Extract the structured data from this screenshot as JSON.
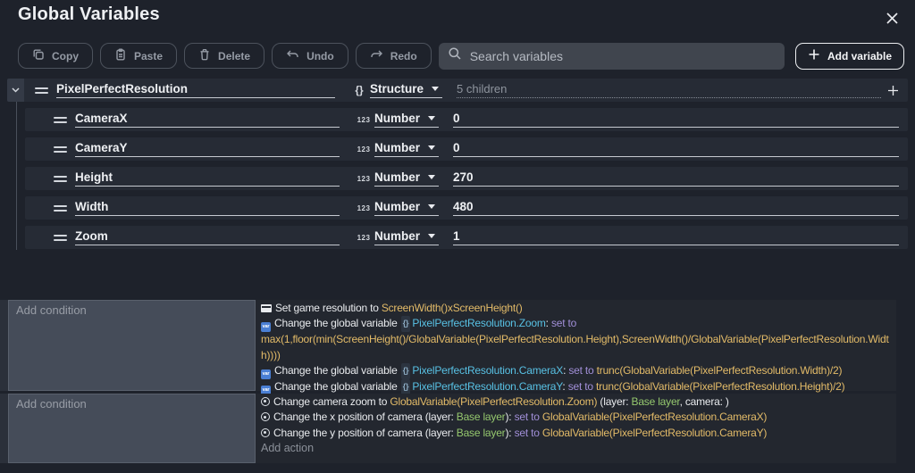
{
  "header": {
    "title": "Global Variables"
  },
  "toolbar": {
    "buttons": [
      {
        "id": "copy",
        "label": "Copy"
      },
      {
        "id": "paste",
        "label": "Paste"
      },
      {
        "id": "delete",
        "label": "Delete"
      },
      {
        "id": "undo",
        "label": "Undo"
      },
      {
        "id": "redo",
        "label": "Redo"
      }
    ],
    "search_placeholder": "Search variables",
    "add_variable_label": "Add variable"
  },
  "icons": {
    "close": "x-cross",
    "copy": "two-overlapping-squares",
    "paste": "clipboard",
    "delete": "trash-can",
    "undo": "arrow-curve-left",
    "redo": "arrow-curve-right",
    "search": "magnifier",
    "add": "plus",
    "collapse": "chevron-down",
    "drag_handle": "double-horizontal-lines",
    "structure_type": "{}",
    "number_type": "123",
    "set_resolution": "window",
    "global_variable": "var-blue-square",
    "camera": "lens-circle-dot"
  },
  "colors": {
    "accent-expression": "#e3bb68",
    "accent-variable": "#58c1e4",
    "accent-set-to": "#a18fd8",
    "accent-layer": "#95c86e"
  },
  "variables": {
    "root": {
      "name": "PixelPerfectResolution",
      "type": "Structure",
      "type_icon": "{}",
      "summary": "5 children"
    },
    "children": [
      {
        "name": "CameraX",
        "type": "Number",
        "type_icon": "123",
        "value": "0"
      },
      {
        "name": "CameraY",
        "type": "Number",
        "type_icon": "123",
        "value": "0"
      },
      {
        "name": "Height",
        "type": "Number",
        "type_icon": "123",
        "value": "270"
      },
      {
        "name": "Width",
        "type": "Number",
        "type_icon": "123",
        "value": "480"
      },
      {
        "name": "Zoom",
        "type": "Number",
        "type_icon": "123",
        "value": "1"
      }
    ]
  },
  "events": [
    {
      "condition_placeholder": "Add condition",
      "add_action_label": "Add action",
      "actions": [
        {
          "icon": "window",
          "segments": [
            {
              "k": "plain",
              "t": "Set game resolution to "
            },
            {
              "k": "expr",
              "t": "ScreenWidth()xScreenHeight()"
            }
          ]
        },
        {
          "icon": "var",
          "segments": [
            {
              "k": "plain",
              "t": "Change the global variable "
            },
            {
              "k": "badge",
              "t": "{}"
            },
            {
              "k": "var",
              "t": "PixelPerfectResolution.Zoom"
            },
            {
              "k": "plain",
              "t": ": "
            },
            {
              "k": "setto",
              "t": "set to"
            },
            {
              "k": "br",
              "t": ""
            },
            {
              "k": "expr",
              "t": "max(1,floor(min(ScreenHeight()/GlobalVariable(PixelPerfectResolution.Height),ScreenWidth()/GlobalVariable(PixelPerfectResolution.Width))))"
            }
          ]
        },
        {
          "icon": "var",
          "segments": [
            {
              "k": "plain",
              "t": "Change the global variable "
            },
            {
              "k": "badge",
              "t": "{}"
            },
            {
              "k": "var",
              "t": "PixelPerfectResolution.CameraX"
            },
            {
              "k": "plain",
              "t": ": "
            },
            {
              "k": "setto",
              "t": "set to "
            },
            {
              "k": "expr",
              "t": "trunc(GlobalVariable(PixelPerfectResolution.Width)/2)"
            }
          ]
        },
        {
          "icon": "var",
          "segments": [
            {
              "k": "plain",
              "t": "Change the global variable "
            },
            {
              "k": "badge",
              "t": "{}"
            },
            {
              "k": "var",
              "t": "PixelPerfectResolution.CameraY"
            },
            {
              "k": "plain",
              "t": ": "
            },
            {
              "k": "setto",
              "t": "set to "
            },
            {
              "k": "expr",
              "t": "trunc(GlobalVariable(PixelPerfectResolution.Height)/2)"
            }
          ]
        }
      ]
    },
    {
      "condition_placeholder": "Add condition",
      "add_action_label": "Add action",
      "actions": [
        {
          "icon": "camera",
          "segments": [
            {
              "k": "plain",
              "t": "Change camera zoom to "
            },
            {
              "k": "expr",
              "t": "GlobalVariable(PixelPerfectResolution.Zoom)"
            },
            {
              "k": "plain",
              "t": " (layer: "
            },
            {
              "k": "layer",
              "t": "Base layer"
            },
            {
              "k": "plain",
              "t": ", camera: )"
            }
          ]
        },
        {
          "icon": "camera",
          "segments": [
            {
              "k": "plain",
              "t": "Change the x position of camera (layer: "
            },
            {
              "k": "layer",
              "t": "Base layer"
            },
            {
              "k": "plain",
              "t": "): "
            },
            {
              "k": "setto",
              "t": "set to "
            },
            {
              "k": "expr",
              "t": "GlobalVariable(PixelPerfectResolution.CameraX)"
            }
          ]
        },
        {
          "icon": "camera",
          "segments": [
            {
              "k": "plain",
              "t": "Change the y position of camera (layer: "
            },
            {
              "k": "layer",
              "t": "Base layer"
            },
            {
              "k": "plain",
              "t": "): "
            },
            {
              "k": "setto",
              "t": "set to "
            },
            {
              "k": "expr",
              "t": "GlobalVariable(PixelPerfectResolution.CameraY)"
            }
          ]
        }
      ]
    }
  ]
}
